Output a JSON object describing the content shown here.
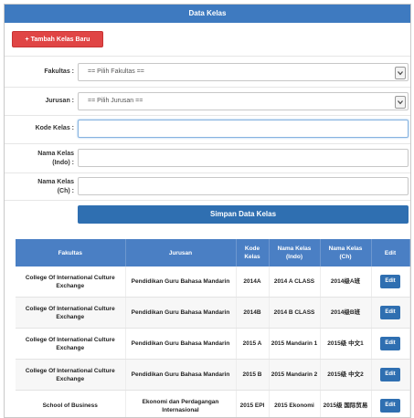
{
  "page": {
    "title": "Data Kelas"
  },
  "add_button": {
    "label": "Tambah Kelas Baru"
  },
  "form": {
    "fakultas": {
      "label": "Fakultas :",
      "value": "== Pilih Fakultas =="
    },
    "jurusan": {
      "label": "Jurusan :",
      "value": "== Pilih Jurusan =="
    },
    "kode_kelas": {
      "label": "Kode Kelas :",
      "value": ""
    },
    "nama_indo": {
      "label_line1": "Nama Kelas",
      "label_line2": "(Indo) :",
      "value": ""
    },
    "nama_ch": {
      "label_line1": "Nama Kelas",
      "label_line2": "(Ch) :",
      "value": ""
    },
    "save_label": "Simpan Data Kelas"
  },
  "table": {
    "headers": [
      "Fakultas",
      "Jurusan",
      "Kode Kelas",
      "Nama Kelas (Indo)",
      "Nama Kelas (Ch)",
      "Edit"
    ],
    "rows": [
      {
        "fakultas": "College Of International Culture Exchange",
        "jurusan": "Pendidikan Guru Bahasa Mandarin",
        "kode": "2014A",
        "indo": "2014 A CLASS",
        "ch": "2014级A班",
        "edit": "Edit"
      },
      {
        "fakultas": "College Of International Culture Exchange",
        "jurusan": "Pendidikan Guru Bahasa Mandarin",
        "kode": "2014B",
        "indo": "2014 B CLASS",
        "ch": "2014级B班",
        "edit": "Edit"
      },
      {
        "fakultas": "College Of International Culture Exchange",
        "jurusan": "Pendidikan Guru Bahasa Mandarin",
        "kode": "2015 A",
        "indo": "2015 Mandarin 1",
        "ch": "2015级 中文1",
        "edit": "Edit"
      },
      {
        "fakultas": "College Of International Culture Exchange",
        "jurusan": "Pendidikan Guru Bahasa Mandarin",
        "kode": "2015 B",
        "indo": "2015 Mandarin 2",
        "ch": "2015级 中文2",
        "edit": "Edit"
      },
      {
        "fakultas": "School of Business",
        "jurusan": "Ekonomi dan Perdagangan Internasional",
        "kode": "2015 EPI",
        "indo": "2015 Ekonomi",
        "ch": "2015级 国际贸易",
        "edit": "Edit"
      }
    ]
  },
  "colors": {
    "header_blue": "#3e7ac0",
    "add_red": "#e04545",
    "save_blue": "#2f6fb1"
  },
  "icons": {
    "add": "plus-icon",
    "dropdown": "chevron-down-icon"
  }
}
